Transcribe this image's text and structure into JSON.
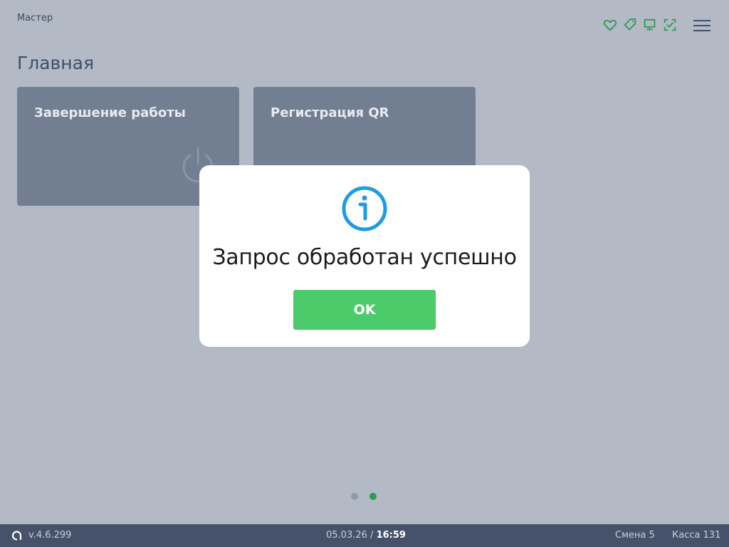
{
  "header": {
    "user_name": "Мастер",
    "status_icons": [
      "heart-icon",
      "tag-icon",
      "monitor-icon",
      "scan-check-icon"
    ],
    "status_color": "#2e9a55"
  },
  "page": {
    "title": "Главная"
  },
  "tiles": [
    {
      "label": "Завершение работы",
      "icon": "power-icon"
    },
    {
      "label": "Регистрация QR",
      "icon": ""
    }
  ],
  "pagination": {
    "total": 2,
    "active_index": 1
  },
  "modal": {
    "icon": "info-icon",
    "icon_color": "#1e9be8",
    "message": "Запрос обработан успешно",
    "ok_label": "OK",
    "ok_color": "#4ccb6a"
  },
  "footer": {
    "version": "v.4.6.299",
    "date": "05.03.26",
    "separator": "/",
    "time": "16:59",
    "shift": "Смена 5",
    "register": "Касса 131"
  }
}
